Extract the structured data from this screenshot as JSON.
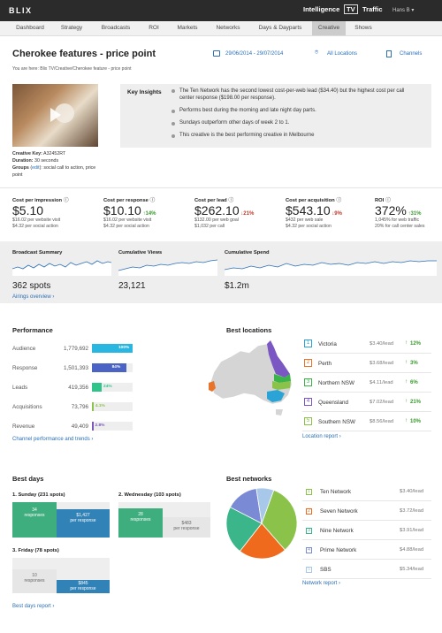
{
  "app": {
    "logo": "BLIX",
    "nav": [
      "Intelligence",
      "TV",
      "Traffic"
    ],
    "user": "Hans B"
  },
  "tabs": [
    "Dashboard",
    "Strategy",
    "Broadcasts",
    "ROI",
    "Markets",
    "Networks",
    "Days & Dayparts",
    "Creative",
    "Shows"
  ],
  "title": "Cherokee features - price point",
  "date_range": "29/06/2014 - 29/07/2014",
  "locations_label": "All Locations",
  "channels_label": "Channels",
  "breadcrumb": "You are here:  Blix TV/Creative/Cherokee feature - price point",
  "creative": {
    "key_label": "Creative Key:",
    "key": "A32452RT",
    "duration_label": "Duration:",
    "duration": "30 seconds",
    "groups_label": "Groups",
    "edit": "edit",
    "groups": ": social call to action, price point"
  },
  "insights": {
    "title": "Key Insights",
    "items": [
      "The Ten Network has the second lowest cost-per-web lead ($34.40) but the highest cost per call center response ($198.00 per response).",
      "Performs best during the morning and late night day parts.",
      "Sundays outperform other days of week 2 to 1.",
      "This creative is the best performing creative in Melbourne"
    ]
  },
  "kpis": [
    {
      "label": "Cost per impression",
      "value": "$5.10",
      "change": "",
      "dir": "",
      "sub1": "$16.02 per website visit",
      "sub2": "$4.32 per social action"
    },
    {
      "label": "Cost per response",
      "value": "$10.10",
      "change": "14%",
      "dir": "up",
      "sub1": "$16.02 per website visit",
      "sub2": "$4.32 per social action"
    },
    {
      "label": "Cost per lead",
      "value": "$262.10",
      "change": "21%",
      "dir": "down",
      "sub1": "$132.00 per web goal",
      "sub2": "$1,032 per call"
    },
    {
      "label": "Cost per acquisition",
      "value": "$543.10",
      "change": "9%",
      "dir": "down",
      "sub1": "$432 per web sale",
      "sub2": "$4.32 per social action"
    },
    {
      "label": "ROI",
      "value": "372%",
      "change": "31%",
      "dir": "up",
      "sub1": "1,045% for web traffic",
      "sub2": "20% for call center sales"
    }
  ],
  "summary": [
    {
      "label": "Broadcast Summary",
      "value": "362 spots"
    },
    {
      "label": "Cumulative Views",
      "value": "23,121"
    },
    {
      "label": "Cumulative Spend",
      "value": "$1.2m"
    }
  ],
  "airings_link": "Airings overview",
  "performance": {
    "title": "Performance",
    "rows": [
      {
        "label": "Audience",
        "value": "1,779,692",
        "pct": "100%",
        "fill": 1.0,
        "color": "#29b6e0"
      },
      {
        "label": "Response",
        "value": "1,501,393",
        "pct": "84%",
        "fill": 0.84,
        "color": "#4a63c4"
      },
      {
        "label": "Leads",
        "value": "419,356",
        "pct": "24%",
        "fill": 0.24,
        "color": "#2ec48a"
      },
      {
        "label": "Acquisitions",
        "value": "73,796",
        "pct": "4.1%",
        "fill": 0.041,
        "color": "#8bc34a"
      },
      {
        "label": "Revenue",
        "value": "49,409",
        "pct": "2.8%",
        "fill": 0.028,
        "color": "#7a57b8"
      }
    ],
    "link": "Channel performance and trends"
  },
  "locations": {
    "title": "Best locations",
    "rows": [
      {
        "n": "1",
        "name": "Victoria",
        "cost": "$3.40/lead",
        "change": "12%",
        "color": "#2aa4d6"
      },
      {
        "n": "2",
        "name": "Perth",
        "cost": "$3.68/lead",
        "change": "3%",
        "color": "#e8732a"
      },
      {
        "n": "3",
        "name": "Northern NSW",
        "cost": "$4.11/lead",
        "change": "6%",
        "color": "#3bb54a"
      },
      {
        "n": "4",
        "name": "Queensland",
        "cost": "$7.02/lead",
        "change": "21%",
        "color": "#7b57c4"
      },
      {
        "n": "5",
        "name": "Southern NSW",
        "cost": "$8.56/lead",
        "change": "10%",
        "color": "#8bc34a"
      }
    ],
    "link": "Location report"
  },
  "days": {
    "title": "Best days",
    "items": [
      {
        "label": "1. Sunday (231 spots)",
        "responses": "34",
        "resp_label": "responses",
        "per": "$1,427",
        "per_label": "per response"
      },
      {
        "label": "2. Wednesday (103 spots)",
        "responses": "28",
        "resp_label": "responses",
        "per": "$483",
        "per_label": "per response"
      },
      {
        "label": "3. Friday (78 spots)",
        "responses": "10",
        "resp_label": "responses",
        "per": "$845",
        "per_label": "per response"
      }
    ],
    "link": "Best days report"
  },
  "networks": {
    "title": "Best networks",
    "rows": [
      {
        "n": "1",
        "name": "Ten Network",
        "cost": "$3.40/lead",
        "color": "#8bc34a",
        "share": 0.33
      },
      {
        "n": "2",
        "name": "Seven Network",
        "cost": "$3.72/lead",
        "color": "#f06a1e",
        "share": 0.22
      },
      {
        "n": "3",
        "name": "Nine Network",
        "cost": "$3.91/lead",
        "color": "#3bb58a",
        "share": 0.22
      },
      {
        "n": "4",
        "name": "Prime Network",
        "cost": "$4.88/lead",
        "color": "#7b8ad4",
        "share": 0.15
      },
      {
        "n": "5",
        "name": "SBS",
        "cost": "$5.34/lead",
        "color": "#a8c8ea",
        "share": 0.08
      }
    ],
    "link": "Network report"
  }
}
